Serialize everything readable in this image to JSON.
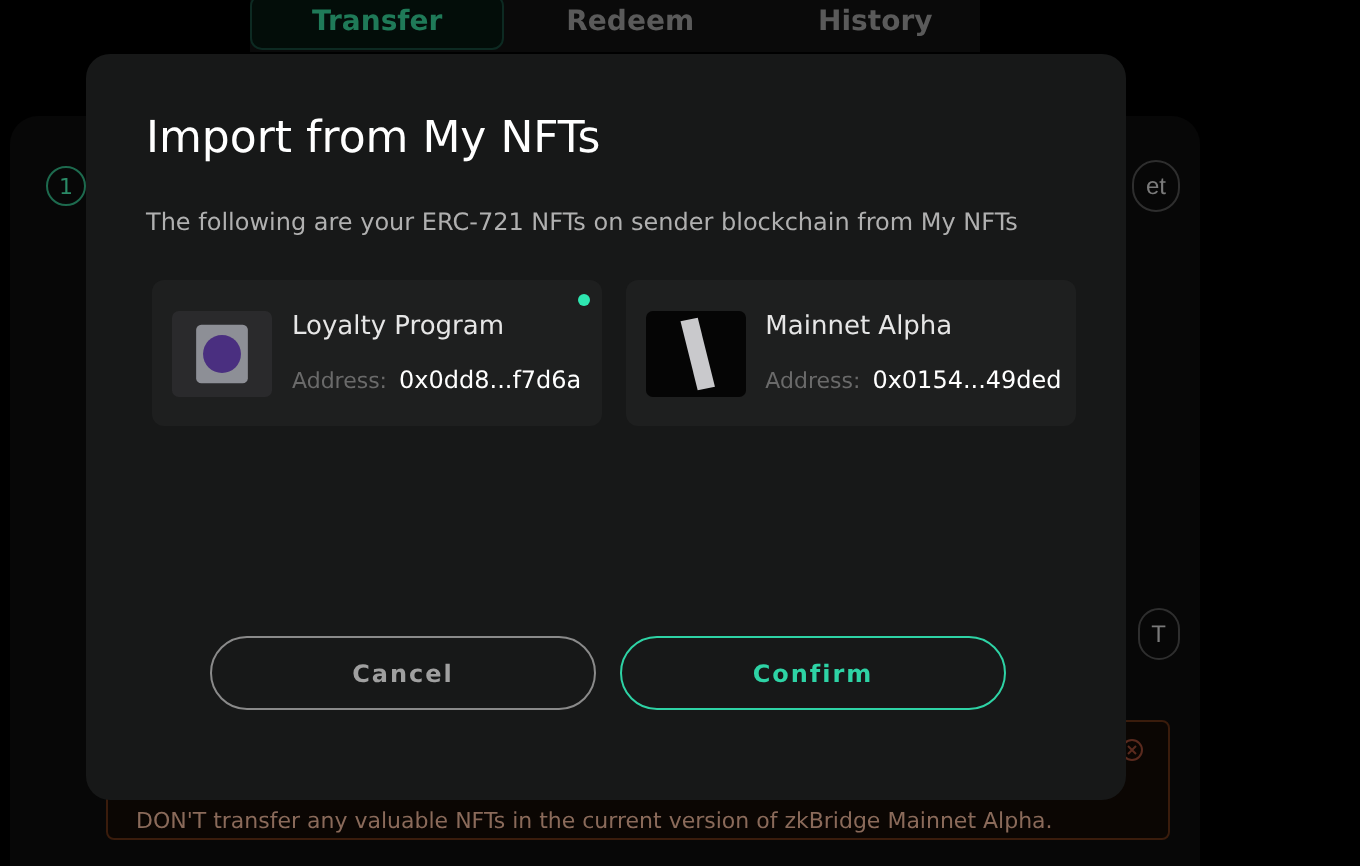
{
  "page_tabs": [
    {
      "label": "Transfer",
      "selected": true
    },
    {
      "label": "Redeem",
      "selected": false
    },
    {
      "label": "History",
      "selected": false
    }
  ],
  "step": {
    "number": "1",
    "side_button": "et",
    "lower_button": "T"
  },
  "warning": {
    "text": "DON'T transfer any valuable NFTs in the current version of zkBridge Mainnet Alpha."
  },
  "dialog": {
    "title": "Import from My NFTs",
    "description": "The following are your ERC-721 NFTs on sender blockchain from My NFTs",
    "nfts": [
      {
        "name": "Loyalty Program",
        "address_label": "Address:",
        "address": "0x0dd8...f7d6a",
        "selected": true
      },
      {
        "name": "Mainnet Alpha",
        "address_label": "Address:",
        "address": "0x0154...49ded",
        "selected": false
      }
    ],
    "buttons": [
      {
        "label": "Cancel",
        "kind": "secondary"
      },
      {
        "label": "Confirm",
        "kind": "primary"
      }
    ]
  }
}
